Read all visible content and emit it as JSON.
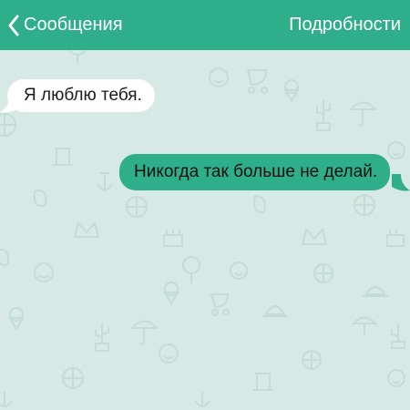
{
  "header": {
    "back_label": "Сообщения",
    "details_label": "Подробности",
    "color": "#2fae8a"
  },
  "messages": [
    {
      "direction": "incoming",
      "text": "Я люблю тебя.",
      "bubble_color": "#ffffff"
    },
    {
      "direction": "outgoing",
      "text": "Никогда так больше не делай.",
      "bubble_color": "#2fae8a"
    }
  ],
  "background": {
    "color": "#d6e9e4",
    "pattern_icons": [
      "tree-icon",
      "cactus-icon",
      "umbrella-icon",
      "crown-icon",
      "cake-icon",
      "leaf-icon",
      "basketball-icon",
      "ice-cream-icon",
      "stroller-icon",
      "cloche-icon",
      "column-icon",
      "anchor-icon",
      "smiley-icon"
    ]
  }
}
